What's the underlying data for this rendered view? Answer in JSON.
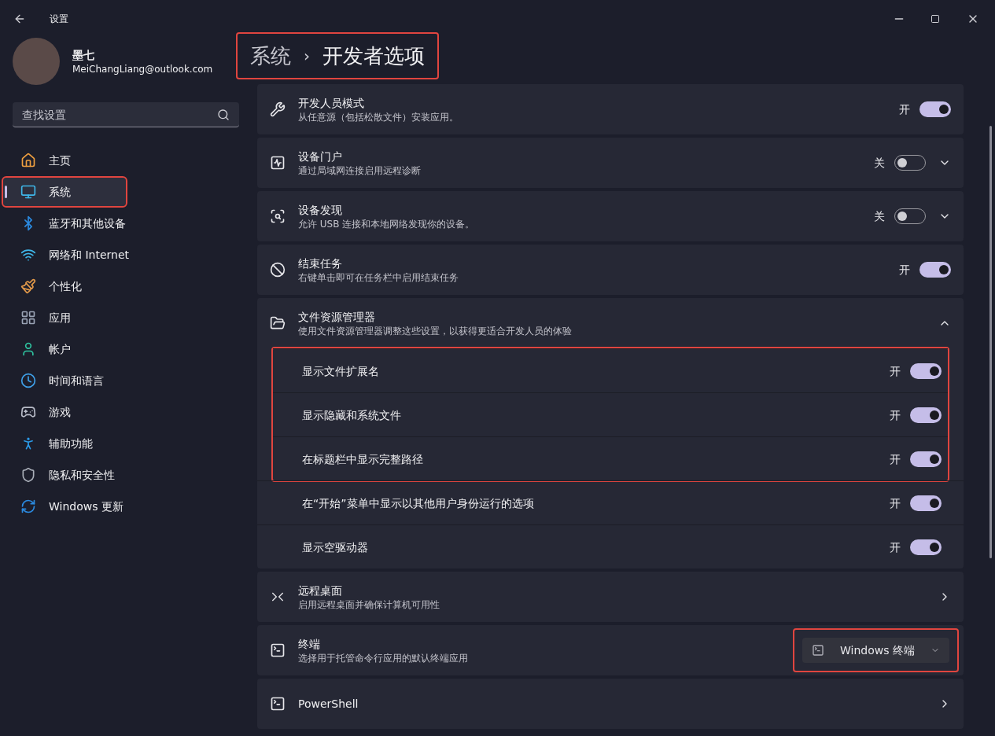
{
  "window": {
    "title": "设置"
  },
  "account": {
    "name": "墨七",
    "email": "MeiChangLiang@outlook.com"
  },
  "search": {
    "placeholder": "查找设置"
  },
  "nav": [
    {
      "kind": "home",
      "label": "主页",
      "selected": false,
      "highlighted": false
    },
    {
      "kind": "system",
      "label": "系统",
      "selected": true,
      "highlighted": true
    },
    {
      "kind": "bluetooth",
      "label": "蓝牙和其他设备",
      "selected": false,
      "highlighted": false
    },
    {
      "kind": "network",
      "label": "网络和 Internet",
      "selected": false,
      "highlighted": false
    },
    {
      "kind": "personalize",
      "label": "个性化",
      "selected": false,
      "highlighted": false
    },
    {
      "kind": "apps",
      "label": "应用",
      "selected": false,
      "highlighted": false
    },
    {
      "kind": "accounts",
      "label": "帐户",
      "selected": false,
      "highlighted": false
    },
    {
      "kind": "time",
      "label": "时间和语言",
      "selected": false,
      "highlighted": false
    },
    {
      "kind": "gaming",
      "label": "游戏",
      "selected": false,
      "highlighted": false
    },
    {
      "kind": "accessibility",
      "label": "辅助功能",
      "selected": false,
      "highlighted": false
    },
    {
      "kind": "privacy",
      "label": "隐私和安全性",
      "selected": false,
      "highlighted": false
    },
    {
      "kind": "update",
      "label": "Windows 更新",
      "selected": false,
      "highlighted": false
    }
  ],
  "breadcrumb": {
    "parent": "系统",
    "separator": "›",
    "current": "开发者选项",
    "highlighted": true
  },
  "settings": [
    {
      "kind": "toggle",
      "title": "开发人员模式",
      "description": "从任意源（包括松散文件）安装应用。",
      "state_label": "开",
      "on": true,
      "expandable": false
    },
    {
      "kind": "toggle",
      "title": "设备门户",
      "description": "通过局域网连接启用远程诊断",
      "state_label": "关",
      "on": false,
      "expandable": true
    },
    {
      "kind": "toggle",
      "title": "设备发现",
      "description": "允许 USB 连接和本地网络发现你的设备。",
      "state_label": "关",
      "on": false,
      "expandable": true
    },
    {
      "kind": "toggle",
      "title": "结束任务",
      "description": "右键单击即可在任务栏中启用结束任务",
      "state_label": "开",
      "on": true,
      "expandable": false
    },
    {
      "kind": "group",
      "title": "文件资源管理器",
      "description": "使用文件资源管理器调整这些设置，以获得更适合开发人员的体验",
      "expanded": true,
      "children": [
        {
          "label": "显示文件扩展名",
          "state_label": "开",
          "on": true,
          "highlighted": true
        },
        {
          "label": "显示隐藏和系统文件",
          "state_label": "开",
          "on": true,
          "highlighted": true
        },
        {
          "label": "在标题栏中显示完整路径",
          "state_label": "开",
          "on": true,
          "highlighted": true
        },
        {
          "label": "在“开始”菜单中显示以其他用户身份运行的选项",
          "state_label": "开",
          "on": true,
          "highlighted": false
        },
        {
          "label": "显示空驱动器",
          "state_label": "开",
          "on": true,
          "highlighted": false
        }
      ]
    },
    {
      "kind": "link",
      "title": "远程桌面",
      "description": "启用远程桌面并确保计算机可用性"
    },
    {
      "kind": "dropdown",
      "title": "终端",
      "description": "选择用于托管命令行应用的默认终端应用",
      "value": "Windows 终端",
      "highlighted": true
    },
    {
      "kind": "link",
      "title": "PowerShell"
    }
  ]
}
